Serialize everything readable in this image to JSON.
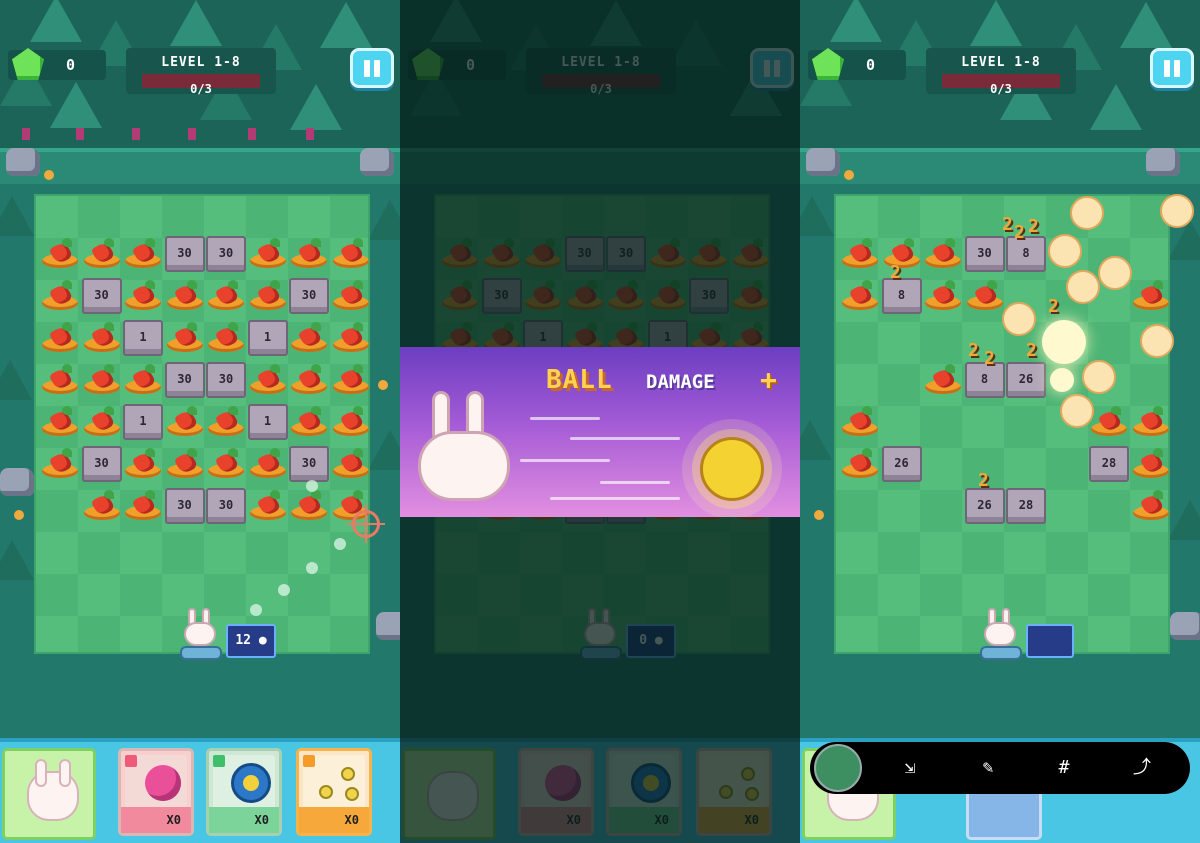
{
  "hud": {
    "gems": "0",
    "level_title": "LEVEL 1-8",
    "level_progress": "0/3"
  },
  "left_panel": {
    "ball_count": "12",
    "board": [
      [
        "carrot",
        "carrot",
        "carrot",
        "30",
        "30",
        "carrot",
        "carrot",
        "carrot"
      ],
      [
        "carrot",
        "30",
        "carrot",
        "carrot",
        "carrot",
        "carrot",
        "30",
        "carrot"
      ],
      [
        "carrot",
        "carrot",
        "1",
        "carrot",
        "carrot",
        "1",
        "carrot",
        "carrot"
      ],
      [
        "carrot",
        "carrot",
        "carrot",
        "30",
        "30",
        "carrot",
        "carrot",
        "carrot"
      ],
      [
        "carrot",
        "carrot",
        "1",
        "carrot",
        "carrot",
        "1",
        "carrot",
        "carrot"
      ],
      [
        "carrot",
        "30",
        "carrot",
        "carrot",
        "carrot",
        "carrot",
        "30",
        "carrot"
      ],
      [
        "",
        "carrot",
        "carrot",
        "30",
        "30",
        "carrot",
        "carrot",
        "carrot"
      ]
    ]
  },
  "middle_panel": {
    "ball_count": "0",
    "banner_title": "BALL",
    "banner_sub": "DAMAGE",
    "banner_plus": "+"
  },
  "right_panel": {
    "board": [
      [
        "carrot",
        "carrot",
        "carrot",
        "30",
        "8",
        "",
        "",
        ""
      ],
      [
        "carrot",
        "8",
        "carrot",
        "carrot",
        "",
        "",
        "",
        "carrot"
      ],
      [
        "",
        "",
        "",
        "",
        "",
        "",
        "",
        ""
      ],
      [
        "",
        "",
        "carrot",
        "8",
        "26",
        "",
        "",
        ""
      ],
      [
        "carrot",
        "",
        "",
        "",
        "",
        "",
        "carrot",
        "carrot"
      ],
      [
        "carrot",
        "26",
        "",
        "",
        "",
        "",
        "28",
        "carrot"
      ],
      [
        "",
        "",
        "",
        "26",
        "28",
        "",
        "",
        "carrot"
      ]
    ],
    "damage_numbers": [
      "2",
      "2",
      "2",
      "2",
      "2",
      "2",
      "2",
      "2",
      "2"
    ]
  },
  "cards": [
    {
      "name": "hero",
      "count": ""
    },
    {
      "name": "bomb",
      "count": "X0"
    },
    {
      "name": "ring-ball",
      "count": "X0"
    },
    {
      "name": "multi-ball",
      "count": "X0"
    }
  ],
  "share_bar": {
    "icons": [
      "scroll-capture-icon",
      "crop-edit-icon",
      "hashtag-icon",
      "share-icon"
    ],
    "hashtag": "#"
  },
  "colors": {
    "grass": "#55be7c",
    "block": "#b1a6b7",
    "carrot": "#e8412c",
    "pause": "#4ed3f0",
    "banner_top": "#6c3ec2",
    "banner_bottom": "#e28fe0"
  }
}
